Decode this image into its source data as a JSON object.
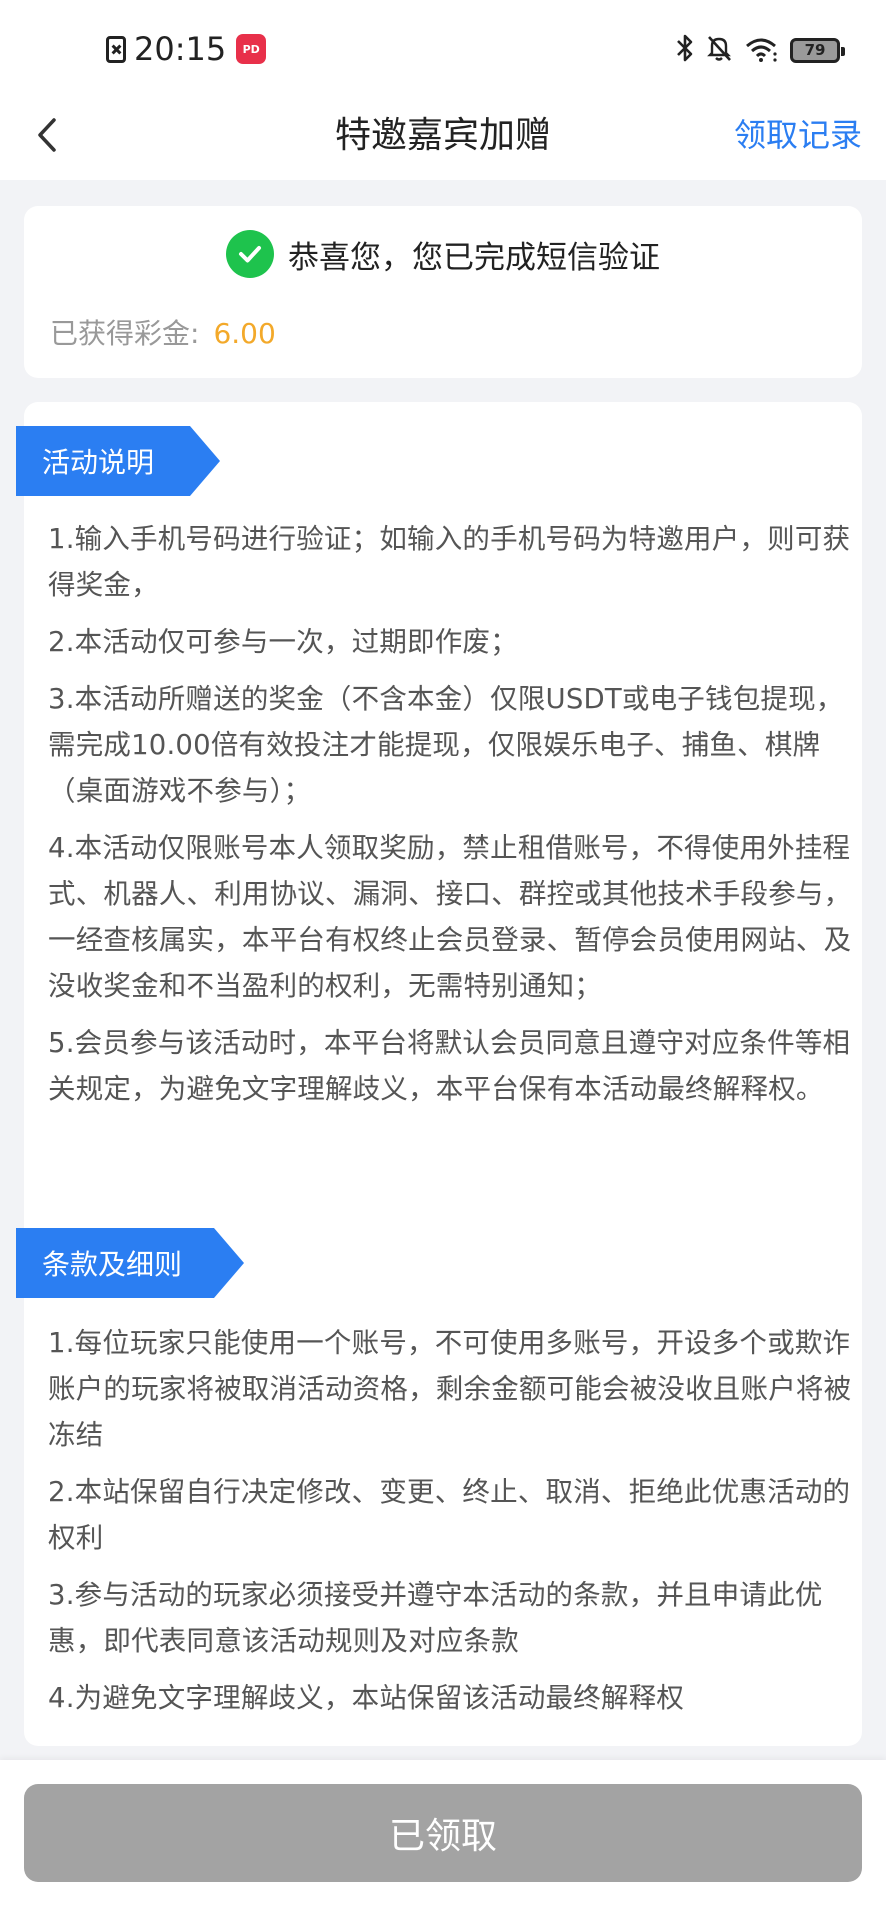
{
  "status_bar": {
    "time": "20:15",
    "app_badge": "PD",
    "battery": "79"
  },
  "nav": {
    "title": "特邀嘉宾加赠",
    "action_label": "领取记录"
  },
  "success": {
    "message": "恭喜您，您已完成短信验证",
    "bonus_label": "已获得彩金:",
    "bonus_value": "6.00"
  },
  "sections": [
    {
      "title": "活动说明",
      "items": [
        "1.输入手机号码进行验证；如输入的手机号码为特邀用户，则可获得奖金，",
        "2.本活动仅可参与一次，过期即作废；",
        "3.本活动所赠送的奖金（不含本金）仅限USDT或电子钱包提现，需完成10.00倍有效投注才能提现，仅限娱乐电子、捕鱼、棋牌（桌面游戏不参与）；",
        "4.本活动仅限账号本人领取奖励，禁止租借账号，不得使用外挂程式、机器人、利用协议、漏洞、接口、群控或其他技术手段参与，一经查核属实，本平台有权终止会员登录、暂停会员使用网站、及没收奖金和不当盈利的权利，无需特别通知；",
        "5.会员参与该活动时，本平台将默认会员同意且遵守对应条件等相关规定，为避免文字理解歧义，本平台保有本活动最终解释权。"
      ]
    },
    {
      "title": "条款及细则",
      "items": [
        "1.每位玩家只能使用一个账号，不可使用多账号，开设多个或欺诈账户的玩家将被取消活动资格，剩余金额可能会被没收且账户将被冻结",
        "2.本站保留自行决定修改、变更、终止、取消、拒绝此优惠活动的权利",
        "3.参与活动的玩家必须接受并遵守本活动的条款，并且申请此优惠，即代表同意该活动规则及对应条款",
        "4.为避免文字理解歧义，本站保留该活动最终解释权"
      ]
    }
  ],
  "footer": {
    "button_label": "已领取"
  },
  "colors": {
    "accent": "#2b7ef2",
    "success": "#1ec34d",
    "bonus": "#f3a92a",
    "disabled_button": "#a3a3a3"
  }
}
